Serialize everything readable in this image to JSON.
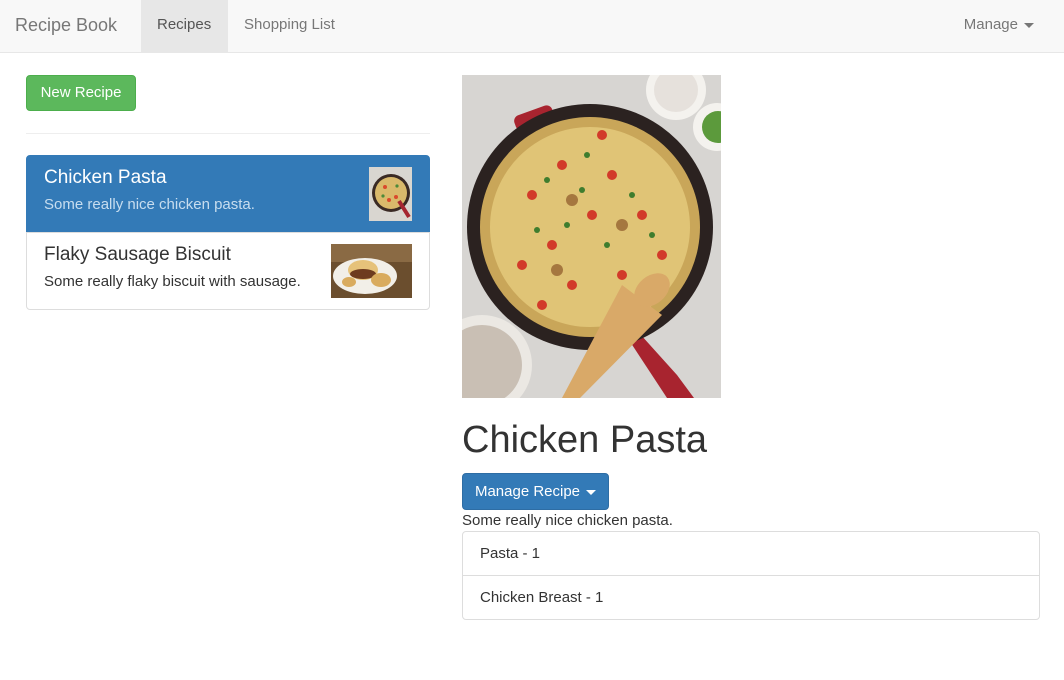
{
  "navbar": {
    "brand": "Recipe Book",
    "links": [
      "Recipes",
      "Shopping List"
    ],
    "active": "Recipes",
    "manage": "Manage"
  },
  "sidebar": {
    "new_button": "New Recipe",
    "recipes": [
      {
        "name": "Chicken Pasta",
        "description": "Some really nice chicken pasta.",
        "selected": true
      },
      {
        "name": "Flaky Sausage Biscuit",
        "description": "Some really flaky biscuit with sausage.",
        "selected": false
      }
    ]
  },
  "detail": {
    "title": "Chicken Pasta",
    "manage_button": "Manage Recipe",
    "description": "Some really nice chicken pasta.",
    "ingredients": [
      "Pasta - 1",
      "Chicken Breast - 1"
    ]
  },
  "colors": {
    "primary": "#337ab7",
    "success": "#5cb85c",
    "navbar_bg": "#f8f8f8"
  }
}
